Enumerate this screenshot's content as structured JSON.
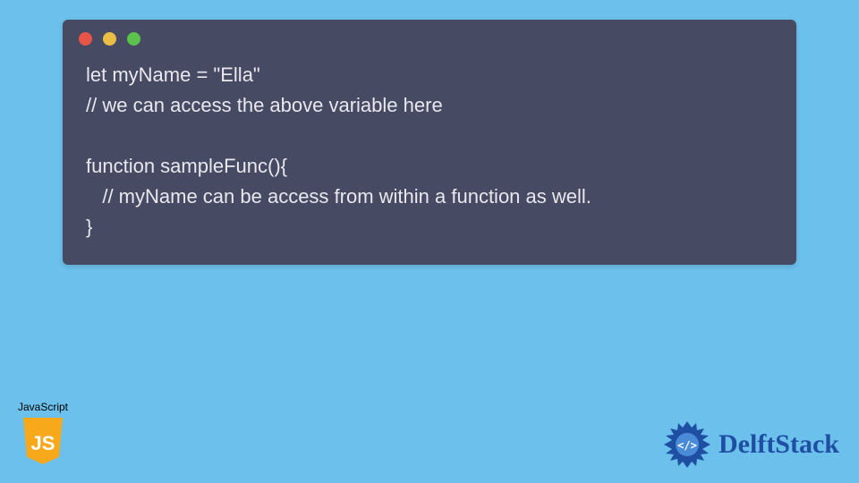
{
  "code": {
    "line1": "let myName = \"Ella\"",
    "line2": "// we can access the above variable here",
    "line3": "",
    "line4": "function sampleFunc(){",
    "line5": "   // myName can be access from within a function as well.",
    "line6": "}"
  },
  "badges": {
    "js_label": "JavaScript",
    "js_text": "JS",
    "brand": "DelftStack"
  },
  "colors": {
    "bg": "#6cc1ec",
    "panel": "#464a63",
    "code_text": "#e8e8ee",
    "red": "#e75448",
    "yellow": "#eabd44",
    "green": "#5bc24b",
    "js_yellow": "#f7a81b",
    "brand_blue": "#1e4fa3"
  }
}
